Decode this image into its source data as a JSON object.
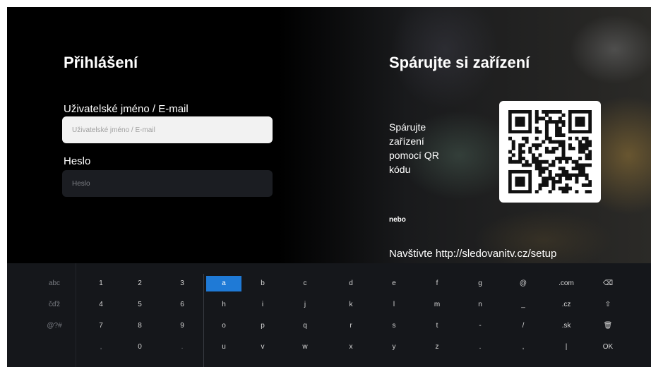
{
  "login": {
    "title": "Přihlášení",
    "username_label": "Uživatelské jméno / E-mail",
    "username_placeholder": "Uživatelské jméno / E-mail",
    "password_label": "Heslo",
    "password_placeholder": "Heslo"
  },
  "pairing": {
    "title": "Spárujte si zařízení",
    "instructions": "Spárujte\nzařízení\npomocí QR\nkódu",
    "or": "nebo",
    "visit": "Navštivte http://sledovanitv.cz/setup"
  },
  "keyboard": {
    "selected_key": "a",
    "mode_keys": [
      "abc",
      "čďž",
      "@?#"
    ],
    "number_rows": [
      [
        "1",
        "2",
        "3"
      ],
      [
        "4",
        "5",
        "6"
      ],
      [
        "7",
        "8",
        "9"
      ],
      [
        ",",
        "0",
        "."
      ]
    ],
    "letter_rows": [
      [
        "a",
        "b",
        "c",
        "d",
        "e",
        "f",
        "g",
        "@",
        ".com"
      ],
      [
        "h",
        "i",
        "j",
        "k",
        "l",
        "m",
        "n",
        "_",
        ".cz"
      ],
      [
        "o",
        "p",
        "q",
        "r",
        "s",
        "t",
        "-",
        "/",
        ".sk"
      ],
      [
        "u",
        "v",
        "w",
        "x",
        "y",
        "z",
        ".",
        ",",
        "|"
      ]
    ],
    "action_keys": [
      {
        "name": "backspace-icon",
        "glyph": "⌫"
      },
      {
        "name": "shift-icon",
        "glyph": "⇧"
      },
      {
        "name": "trash-icon",
        "glyph": "🗑"
      },
      {
        "name": "ok-button",
        "glyph": "OK"
      }
    ]
  }
}
